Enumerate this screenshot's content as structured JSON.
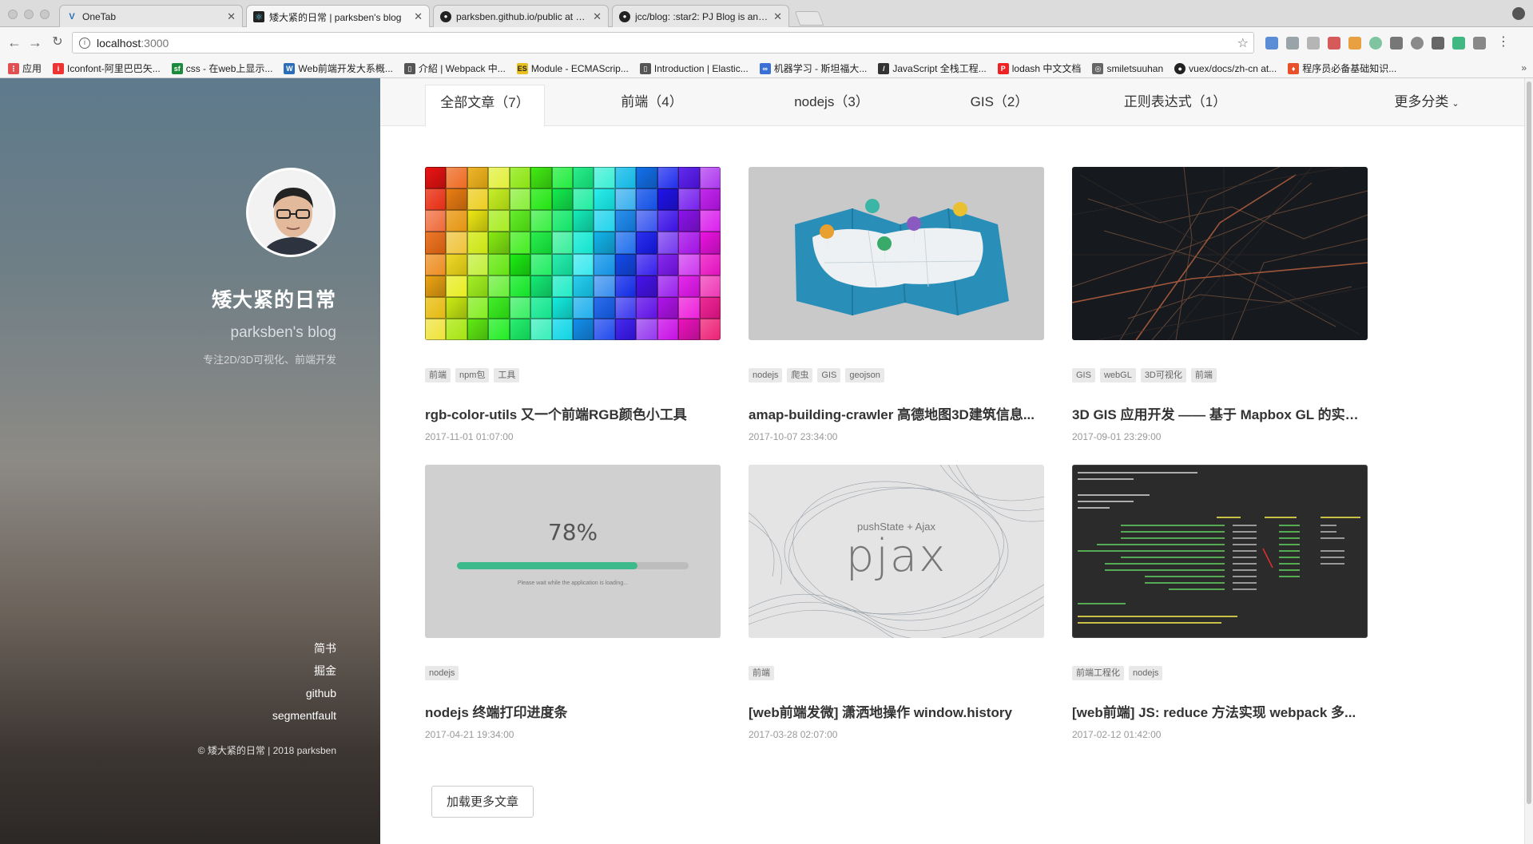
{
  "browser": {
    "tabs": [
      {
        "title": "OneTab",
        "icon": "onetab-icon",
        "active": false
      },
      {
        "title": "矮大紧的日常 | parksben's blog",
        "icon": "react-icon",
        "active": true
      },
      {
        "title": "parksben.github.io/public at b...",
        "icon": "github-icon",
        "active": false
      },
      {
        "title": "jcc/blog: :star2: PJ Blog is an o...",
        "icon": "github-icon",
        "active": false
      }
    ],
    "url_host": "localhost",
    "url_port": ":3000",
    "bookmarks": [
      "应用",
      "Iconfont-阿里巴巴矢...",
      "css - 在web上显示...",
      "Web前端开发大系概...",
      "介紹 | Webpack 中...",
      "Module - ECMAScrip...",
      "Introduction | Elastic...",
      "机器学习 - 斯坦福大...",
      "JavaScript 全栈工程...",
      "lodash 中文文档",
      "smiletsuuhan",
      "vuex/docs/zh-cn at...",
      "程序员必备基础知识..."
    ],
    "bookmarks_more": "»"
  },
  "sidebar": {
    "title": "矮大紧的日常",
    "subtitle": "parksben's blog",
    "description": "专注2D/3D可视化、前端开发",
    "links": [
      "简书",
      "掘金",
      "github",
      "segmentfault"
    ],
    "copyright": "© 矮大紧的日常 | 2018 parksben"
  },
  "categories": [
    {
      "label": "全部文章（7）",
      "active": true
    },
    {
      "label": "前端（4）",
      "active": false
    },
    {
      "label": "nodejs（3）",
      "active": false
    },
    {
      "label": "GIS（2）",
      "active": false
    },
    {
      "label": "正则表达式（1）",
      "active": false
    },
    {
      "label": "更多分类",
      "active": false
    }
  ],
  "posts": [
    {
      "tags": [
        "前端",
        "npm包",
        "工具"
      ],
      "title": "rgb-color-utils 又一个前端RGB颜色小工具",
      "date": "2017-11-01 01:07:00",
      "thumb": "color-cubes"
    },
    {
      "tags": [
        "nodejs",
        "爬虫",
        "GIS",
        "geojson"
      ],
      "title": "amap-building-crawler 高德地图3D建筑信息...",
      "date": "2017-10-07 23:34:00",
      "thumb": "map"
    },
    {
      "tags": [
        "GIS",
        "webGL",
        "3D可视化",
        "前端"
      ],
      "title": "3D GIS 应用开发 —— 基于 Mapbox GL 的实践...",
      "date": "2017-09-01 23:29:00",
      "thumb": "dark-map"
    },
    {
      "tags": [
        "nodejs"
      ],
      "title": "nodejs 终端打印进度条",
      "date": "2017-04-21 19:34:00",
      "thumb": "progress"
    },
    {
      "tags": [
        "前端"
      ],
      "title": "[web前端发微] 潇洒地操作 window.history",
      "date": "2017-03-28 02:07:00",
      "thumb": "pjax"
    },
    {
      "tags": [
        "前端工程化",
        "nodejs"
      ],
      "title": "[web前端] JS: reduce 方法实现 webpack 多...",
      "date": "2017-02-12 01:42:00",
      "thumb": "terminal"
    }
  ],
  "thumb_text": {
    "progress_percent": "78%",
    "progress_value": 0.78,
    "progress_caption": "Please wait while the application is loading...",
    "pjax_sub": "pushState + Ajax",
    "pjax_main": "pjax"
  },
  "load_more_label": "加载更多文章",
  "colors": {
    "accent": "#3cba8c",
    "tag_bg": "#e9e9e9",
    "link": "#ffffff"
  }
}
